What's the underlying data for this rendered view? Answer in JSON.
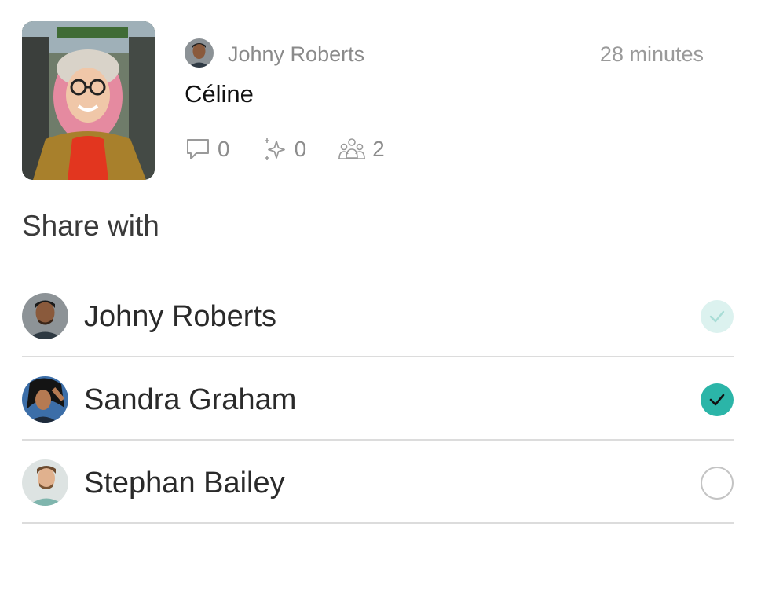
{
  "post": {
    "author_name": "Johny Roberts",
    "time": "28 minutes",
    "title": "Céline",
    "stats": {
      "comments": "0",
      "highlights": "0",
      "participants": "2"
    }
  },
  "share": {
    "heading": "Share with",
    "people": [
      {
        "name": "Johny Roberts",
        "state": "checked-disabled"
      },
      {
        "name": "Sandra Graham",
        "state": "checked"
      },
      {
        "name": "Stephan Bailey",
        "state": "unchecked"
      }
    ]
  },
  "colors": {
    "accent": "#2bb5a8",
    "accent_light": "#dcf2ef",
    "divider": "#dcdcdc",
    "muted_text": "#8a8a8a"
  },
  "icons": {
    "comments": "speech-bubble-icon",
    "highlights": "sparkle-icon",
    "participants": "people-group-icon",
    "check": "checkmark-icon"
  }
}
